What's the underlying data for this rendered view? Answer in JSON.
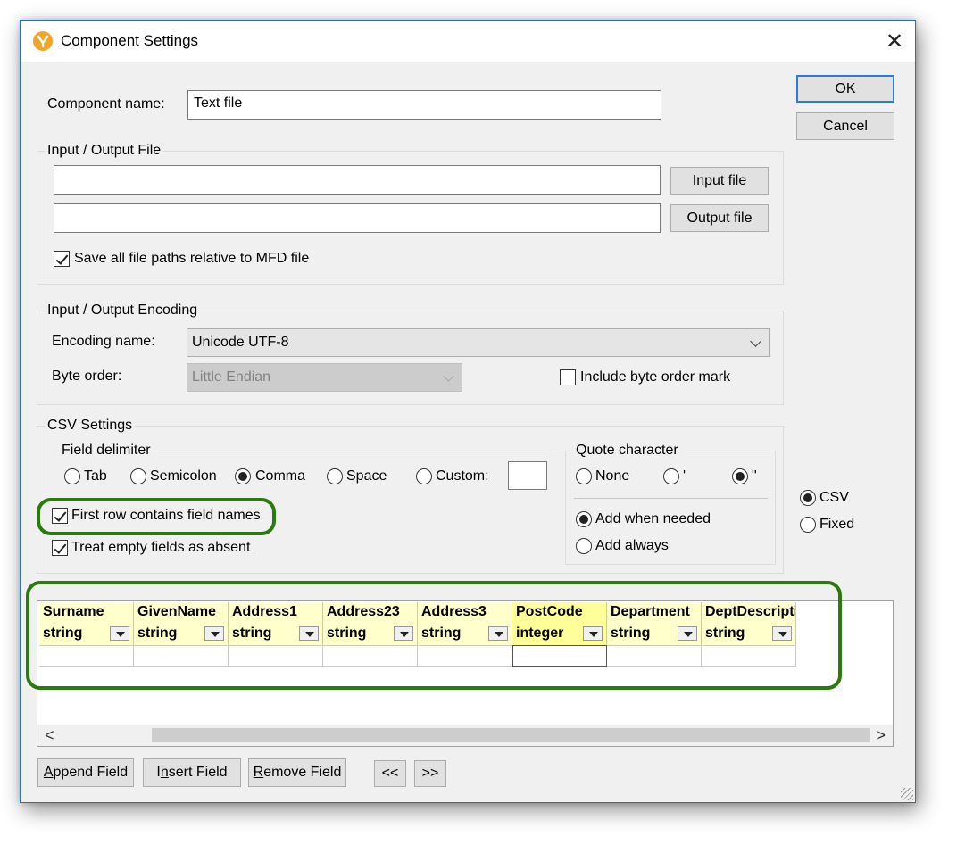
{
  "window": {
    "title": "Component Settings",
    "close_label": "✕"
  },
  "component_name": {
    "label": "Component name:",
    "value": "Text file"
  },
  "buttons": {
    "ok": "OK",
    "cancel": "Cancel"
  },
  "io_file": {
    "group_label": "Input / Output File",
    "input_value": "",
    "output_value": "",
    "input_button": "Input file",
    "output_button": "Output file",
    "relative_paths_label": "Save all file paths relative to MFD file",
    "relative_paths_checked": true
  },
  "encoding": {
    "group_label": "Input / Output Encoding",
    "name_label": "Encoding name:",
    "name_value": "Unicode UTF-8",
    "byte_order_label": "Byte order:",
    "byte_order_value": "Little Endian",
    "bom_label": "Include byte order mark",
    "bom_checked": false
  },
  "csv": {
    "group_label": "CSV Settings",
    "field_delimiter": {
      "label": "Field delimiter",
      "options": [
        "Tab",
        "Semicolon",
        "Comma",
        "Space",
        "Custom:"
      ],
      "selected": "Comma",
      "custom_value": ""
    },
    "quote_character": {
      "label": "Quote character",
      "options": [
        "None",
        "'",
        "\""
      ],
      "selected": "\"",
      "when_options": [
        "Add when needed",
        "Add always"
      ],
      "when_selected": "Add when needed"
    },
    "first_row_label": "First row contains field names",
    "first_row_checked": true,
    "empty_absent_label": "Treat empty fields as absent",
    "empty_absent_checked": true
  },
  "format": {
    "options": [
      "CSV",
      "Fixed"
    ],
    "selected": "CSV"
  },
  "fields": [
    {
      "name": "Surname",
      "type": "string"
    },
    {
      "name": "GivenName",
      "type": "string"
    },
    {
      "name": "Address1",
      "type": "string"
    },
    {
      "name": "Address23",
      "type": "string"
    },
    {
      "name": "Address3",
      "type": "string"
    },
    {
      "name": "PostCode",
      "type": "integer",
      "selected": true
    },
    {
      "name": "Department",
      "type": "string"
    },
    {
      "name": "DeptDescripti...",
      "type": "string"
    }
  ],
  "scroll": {
    "left": "<",
    "right": ">"
  },
  "bottom_buttons": {
    "append_u": "A",
    "append_rest": "ppend Field",
    "insert_pre": "I",
    "insert_u": "n",
    "insert_rest": "sert Field",
    "remove_u": "R",
    "remove_rest": "emove Field",
    "prev": "<<",
    "next": ">>"
  },
  "colors": {
    "highlight": "#2b7a10",
    "accent": "#2e7bd6",
    "field_header": "#ffffcc"
  }
}
